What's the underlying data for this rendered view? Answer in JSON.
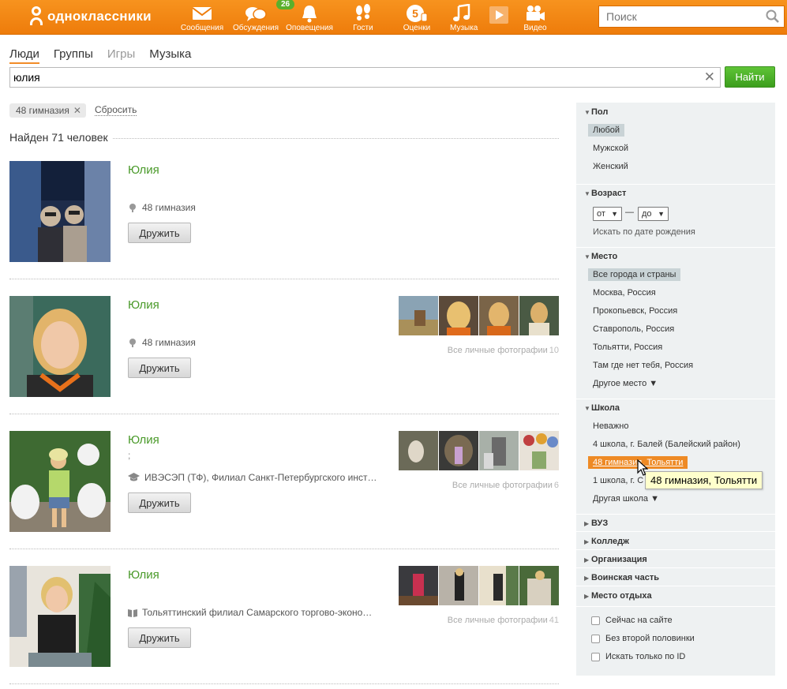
{
  "brand": {
    "name": "одноклассники"
  },
  "nav": [
    {
      "label": "Сообщения",
      "icon": "envelope-icon"
    },
    {
      "label": "Обсуждения",
      "icon": "chat-bubbles-icon",
      "badge": "26"
    },
    {
      "label": "Оповещения",
      "icon": "bell-icon"
    },
    {
      "label": "Гости",
      "icon": "footprints-icon"
    },
    {
      "label": "Оценки",
      "icon": "rating-five-icon"
    },
    {
      "label": "Музыка",
      "icon": "music-note-icon"
    },
    {
      "label": "Видео",
      "icon": "video-camera-icon"
    }
  ],
  "top_search": {
    "placeholder": "Поиск"
  },
  "tabs": [
    {
      "label": "Люди",
      "active": true
    },
    {
      "label": "Группы"
    },
    {
      "label": "Игры"
    },
    {
      "label": "Музыка"
    }
  ],
  "search": {
    "value": "юлия",
    "button": "Найти"
  },
  "filters": {
    "chip": "48 гимназия",
    "reset": "Сбросить"
  },
  "results": {
    "found": "Найден 71 человек",
    "items": [
      {
        "name": "Юлия",
        "sub": "",
        "school_icon": "pin-icon",
        "school": "48 гимназия",
        "button": "Дружить",
        "photos_link": "",
        "photos_count": ""
      },
      {
        "name": "Юлия",
        "sub": "",
        "school_icon": "pin-icon",
        "school": "48 гимназия",
        "button": "Дружить",
        "photos_link": "Все личные фотографии",
        "photos_count": "10"
      },
      {
        "name": "Юлия",
        "sub": ";",
        "school_icon": "graduation-cap-icon",
        "school": "ИВЭСЭП (ТФ), Филиал Санкт-Петербургского инст…",
        "button": "Дружить",
        "photos_link": "Все личные фотографии",
        "photos_count": "6"
      },
      {
        "name": "Юлия",
        "sub": "",
        "school_icon": "book-icon",
        "school": "Тольяттинский филиал Самарского торгово-эконо…",
        "button": "Дружить",
        "photos_link": "Все личные фотографии",
        "photos_count": "41"
      }
    ]
  },
  "sidebar": {
    "gender": {
      "title": "Пол",
      "options": [
        "Любой",
        "Мужской",
        "Женский"
      ]
    },
    "age": {
      "title": "Возраст",
      "from": "от",
      "dash": "—",
      "to": "до",
      "birth_link": "Искать по дате рождения"
    },
    "place": {
      "title": "Место",
      "options": [
        "Все города и страны",
        "Москва, Россия",
        "Прокопьевск, Россия",
        "Ставрополь, Россия",
        "Тольятти, Россия",
        "Там где нет тебя, Россия",
        "Другое место ▼"
      ]
    },
    "school": {
      "title": "Школа",
      "options": [
        "Неважно",
        "4 школа, г. Балей (Балейский район)",
        "48 гимназия, Тольятти",
        "1 школа, г. С",
        "Другая школа ▼"
      ]
    },
    "collapsed": [
      "ВУЗ",
      "Колледж",
      "Организация",
      "Воинская часть",
      "Место отдыха"
    ],
    "checks": [
      "Сейчас на сайте",
      "Без второй половинки",
      "Искать только по ID"
    ]
  },
  "tooltip": "48 гимназия, Тольятти"
}
